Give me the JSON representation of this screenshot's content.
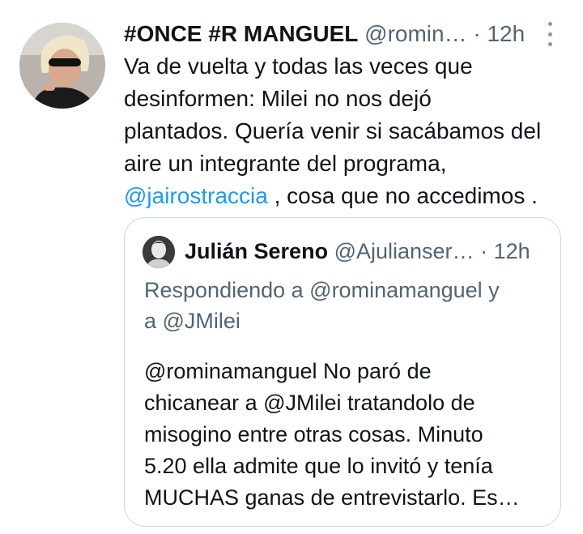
{
  "tweet": {
    "display_name": "#ONCE #R MANGUEL",
    "handle": "@romin…",
    "separator": "·",
    "time": "12h",
    "more_icon": "more-vertical-icon",
    "avatar_icon": "profile-photo",
    "text_lines": [
      "Va de vuelta y todas las veces que",
      "desinformen: Milei no nos dejó",
      "plantados. Quería venir si sacábamos del",
      "aire un integrante del programa,"
    ],
    "last_line_mention": "@jairostraccia",
    "last_line_rest": " , cosa que no accedimos ."
  },
  "quote": {
    "display_name": "Julián Sereno",
    "handle": "@Ajulianser…",
    "separator": "·",
    "time": "12h",
    "avatar_icon": "profile-photo",
    "reply_lines": [
      "Respondiendo a @rominamanguel y",
      "a @JMilei"
    ],
    "text_lines": [
      "@rominamanguel No paró de",
      "chicanear a @JMilei tratandolo de",
      "misogino entre otras cosas. Minuto",
      "5.20 ella admite que lo invitó y tenía",
      "MUCHAS ganas de entrevistarlo. Es…"
    ]
  },
  "colors": {
    "text": "#0f1419",
    "secondary": "#536471",
    "link": "#1d9bf0",
    "border": "#cfd9de"
  }
}
